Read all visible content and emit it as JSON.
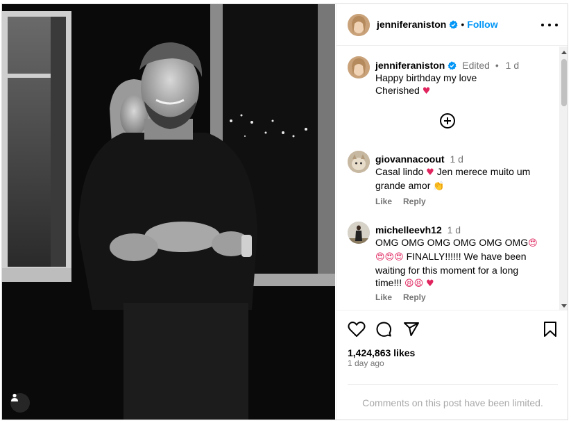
{
  "post": {
    "username": "jenniferaniston",
    "follow_label": "Follow",
    "dot": "•",
    "more_label": "More options"
  },
  "caption": {
    "username": "jenniferaniston",
    "edited": "Edited",
    "dot": "•",
    "time": "1 d",
    "line1": "Happy birthday my love",
    "line2": "Cherished",
    "emoji": "♥"
  },
  "comments": [
    {
      "username": "giovannacoout",
      "time": "1 d",
      "line1": "Casal lindo",
      "heart": "♥",
      "line1b": "Jen merece muito um",
      "line2": "grande amor",
      "emoji2": "👏",
      "like": "Like",
      "reply": "Reply"
    },
    {
      "username": "michelleevh12",
      "time": "1 d",
      "line1": "OMG OMG OMG OMG OMG OMG",
      "emoji_a": "😍",
      "emoji_b": "😍😍😍",
      "line2": "FINALLY!!!!!! We have been",
      "line3": "waiting for this moment for a long",
      "line4": "time!!!",
      "emoji_c": "😫😫",
      "heart": "♥",
      "like": "Like",
      "reply": "Reply"
    }
  ],
  "stats": {
    "likes": "1,424,863 likes",
    "ago": "1 day ago"
  },
  "footer": {
    "limited": "Comments on this post have been limited."
  },
  "colors": {
    "accent": "#0095f6",
    "verified": "#0095f6",
    "heart": "#e0245e",
    "muted": "#737373"
  },
  "icons": [
    "heart-icon",
    "comment-icon",
    "share-icon",
    "save-icon",
    "add-circle-icon",
    "verified-badge-icon",
    "user-tag-icon"
  ]
}
